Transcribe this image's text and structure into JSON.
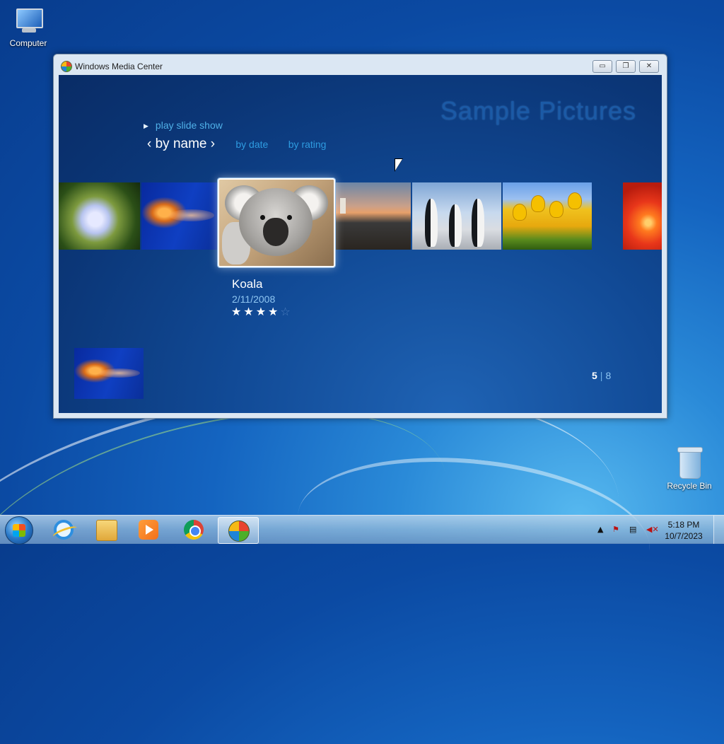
{
  "desktop": {
    "icons": [
      {
        "label": "Computer"
      },
      {
        "label": "Recycle Bin"
      }
    ]
  },
  "window": {
    "title": "Windows Media Center",
    "buttons": {
      "minimize": "▭",
      "restore": "❐",
      "close": "✕"
    }
  },
  "media_center": {
    "section_title": "Sample Pictures",
    "play_label": "play slide show",
    "sort": {
      "selected": "by name",
      "options": [
        "by date",
        "by rating"
      ]
    },
    "selected_item": {
      "name": "Koala",
      "date": "2/11/2008",
      "rating": 4,
      "rating_max": 5
    },
    "pager": {
      "current": "5",
      "total": "8"
    },
    "thumbnails": [
      "hydrangea",
      "jellyfish",
      "koala",
      "lighthouse",
      "penguins",
      "tulips",
      "chrysanthemum"
    ]
  },
  "taskbar": {
    "apps": [
      "start-button",
      "internet-explorer",
      "file-explorer",
      "media-player",
      "chrome",
      "media-center"
    ],
    "clock": {
      "time": "5:18 PM",
      "date": "10/7/2023"
    }
  }
}
